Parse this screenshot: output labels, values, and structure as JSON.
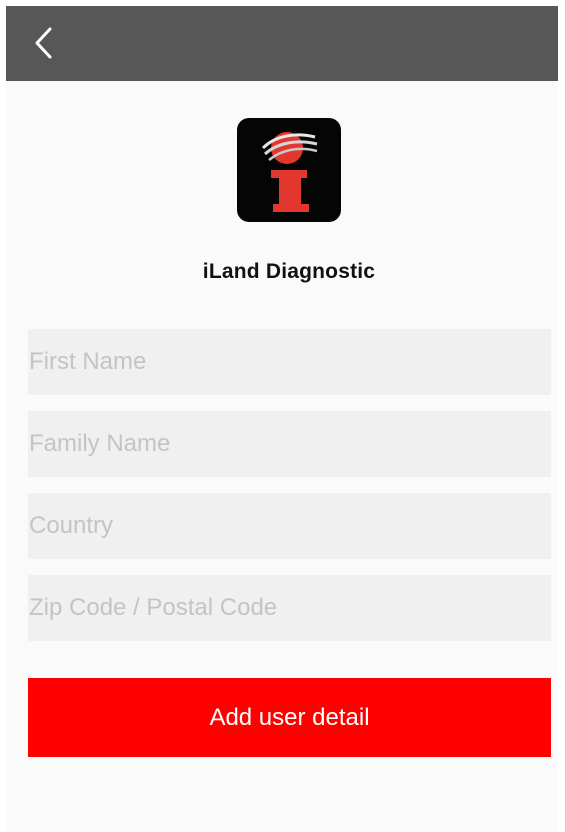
{
  "colors": {
    "navbar": "#575757",
    "background": "#fafafa",
    "field_background": "#f0f0f0",
    "placeholder": "#c4c4c4",
    "accent": "#fe0000",
    "button_text": "#ffffff",
    "logo_background": "#050505",
    "logo_red": "#e2372f"
  },
  "navbar": {
    "back_icon": "chevron-left-icon"
  },
  "app": {
    "logo_icon": "iland-logo-icon",
    "title": "iLand Diagnostic"
  },
  "form": {
    "fields": [
      {
        "value": "",
        "placeholder": "First Name"
      },
      {
        "value": "",
        "placeholder": "Family Name"
      },
      {
        "value": "",
        "placeholder": "Country"
      },
      {
        "value": "",
        "placeholder": "Zip Code / Postal Code"
      }
    ],
    "submit_label": "Add user detail"
  }
}
